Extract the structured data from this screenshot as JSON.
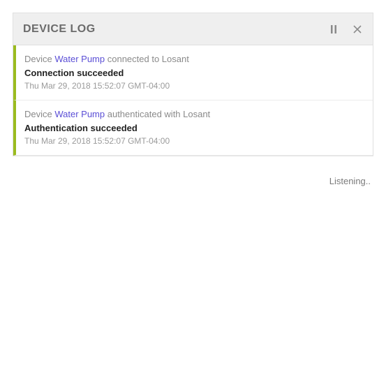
{
  "header": {
    "title": "DEVICE LOG"
  },
  "entries": [
    {
      "prefix": "Device ",
      "link": "Water Pump",
      "suffix": " connected to Losant",
      "message": "Connection succeeded",
      "timestamp": "Thu Mar 29, 2018 15:52:07 GMT-04:00",
      "accent": "#9bbb1f"
    },
    {
      "prefix": "Device ",
      "link": "Water Pump",
      "suffix": " authenticated with Losant",
      "message": "Authentication succeeded",
      "timestamp": "Thu Mar 29, 2018 15:52:07 GMT-04:00",
      "accent": "#9bbb1f"
    }
  ],
  "status": "Listening.."
}
